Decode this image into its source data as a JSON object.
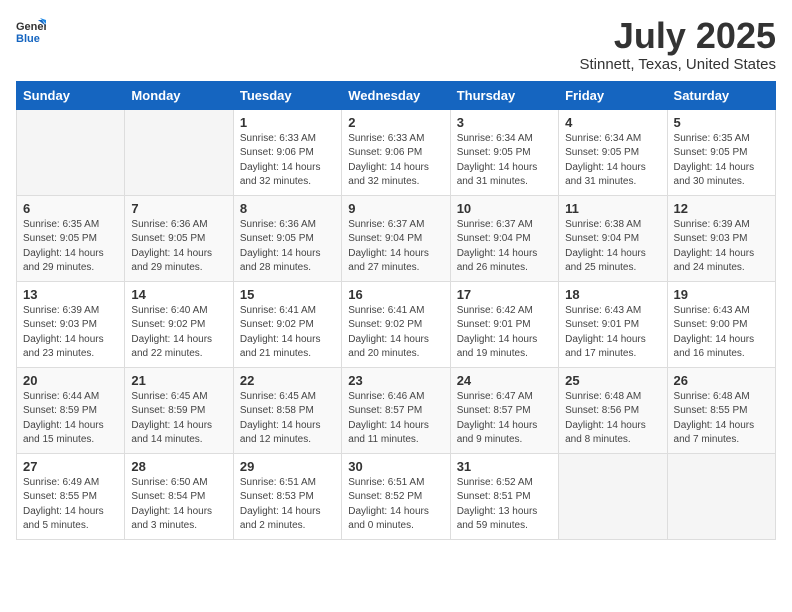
{
  "header": {
    "logo_general": "General",
    "logo_blue": "Blue",
    "month": "July 2025",
    "location": "Stinnett, Texas, United States"
  },
  "weekdays": [
    "Sunday",
    "Monday",
    "Tuesday",
    "Wednesday",
    "Thursday",
    "Friday",
    "Saturday"
  ],
  "weeks": [
    [
      {
        "day": "",
        "sunrise": "",
        "sunset": "",
        "daylight": ""
      },
      {
        "day": "",
        "sunrise": "",
        "sunset": "",
        "daylight": ""
      },
      {
        "day": "1",
        "sunrise": "Sunrise: 6:33 AM",
        "sunset": "Sunset: 9:06 PM",
        "daylight": "Daylight: 14 hours and 32 minutes."
      },
      {
        "day": "2",
        "sunrise": "Sunrise: 6:33 AM",
        "sunset": "Sunset: 9:06 PM",
        "daylight": "Daylight: 14 hours and 32 minutes."
      },
      {
        "day": "3",
        "sunrise": "Sunrise: 6:34 AM",
        "sunset": "Sunset: 9:05 PM",
        "daylight": "Daylight: 14 hours and 31 minutes."
      },
      {
        "day": "4",
        "sunrise": "Sunrise: 6:34 AM",
        "sunset": "Sunset: 9:05 PM",
        "daylight": "Daylight: 14 hours and 31 minutes."
      },
      {
        "day": "5",
        "sunrise": "Sunrise: 6:35 AM",
        "sunset": "Sunset: 9:05 PM",
        "daylight": "Daylight: 14 hours and 30 minutes."
      }
    ],
    [
      {
        "day": "6",
        "sunrise": "Sunrise: 6:35 AM",
        "sunset": "Sunset: 9:05 PM",
        "daylight": "Daylight: 14 hours and 29 minutes."
      },
      {
        "day": "7",
        "sunrise": "Sunrise: 6:36 AM",
        "sunset": "Sunset: 9:05 PM",
        "daylight": "Daylight: 14 hours and 29 minutes."
      },
      {
        "day": "8",
        "sunrise": "Sunrise: 6:36 AM",
        "sunset": "Sunset: 9:05 PM",
        "daylight": "Daylight: 14 hours and 28 minutes."
      },
      {
        "day": "9",
        "sunrise": "Sunrise: 6:37 AM",
        "sunset": "Sunset: 9:04 PM",
        "daylight": "Daylight: 14 hours and 27 minutes."
      },
      {
        "day": "10",
        "sunrise": "Sunrise: 6:37 AM",
        "sunset": "Sunset: 9:04 PM",
        "daylight": "Daylight: 14 hours and 26 minutes."
      },
      {
        "day": "11",
        "sunrise": "Sunrise: 6:38 AM",
        "sunset": "Sunset: 9:04 PM",
        "daylight": "Daylight: 14 hours and 25 minutes."
      },
      {
        "day": "12",
        "sunrise": "Sunrise: 6:39 AM",
        "sunset": "Sunset: 9:03 PM",
        "daylight": "Daylight: 14 hours and 24 minutes."
      }
    ],
    [
      {
        "day": "13",
        "sunrise": "Sunrise: 6:39 AM",
        "sunset": "Sunset: 9:03 PM",
        "daylight": "Daylight: 14 hours and 23 minutes."
      },
      {
        "day": "14",
        "sunrise": "Sunrise: 6:40 AM",
        "sunset": "Sunset: 9:02 PM",
        "daylight": "Daylight: 14 hours and 22 minutes."
      },
      {
        "day": "15",
        "sunrise": "Sunrise: 6:41 AM",
        "sunset": "Sunset: 9:02 PM",
        "daylight": "Daylight: 14 hours and 21 minutes."
      },
      {
        "day": "16",
        "sunrise": "Sunrise: 6:41 AM",
        "sunset": "Sunset: 9:02 PM",
        "daylight": "Daylight: 14 hours and 20 minutes."
      },
      {
        "day": "17",
        "sunrise": "Sunrise: 6:42 AM",
        "sunset": "Sunset: 9:01 PM",
        "daylight": "Daylight: 14 hours and 19 minutes."
      },
      {
        "day": "18",
        "sunrise": "Sunrise: 6:43 AM",
        "sunset": "Sunset: 9:01 PM",
        "daylight": "Daylight: 14 hours and 17 minutes."
      },
      {
        "day": "19",
        "sunrise": "Sunrise: 6:43 AM",
        "sunset": "Sunset: 9:00 PM",
        "daylight": "Daylight: 14 hours and 16 minutes."
      }
    ],
    [
      {
        "day": "20",
        "sunrise": "Sunrise: 6:44 AM",
        "sunset": "Sunset: 8:59 PM",
        "daylight": "Daylight: 14 hours and 15 minutes."
      },
      {
        "day": "21",
        "sunrise": "Sunrise: 6:45 AM",
        "sunset": "Sunset: 8:59 PM",
        "daylight": "Daylight: 14 hours and 14 minutes."
      },
      {
        "day": "22",
        "sunrise": "Sunrise: 6:45 AM",
        "sunset": "Sunset: 8:58 PM",
        "daylight": "Daylight: 14 hours and 12 minutes."
      },
      {
        "day": "23",
        "sunrise": "Sunrise: 6:46 AM",
        "sunset": "Sunset: 8:57 PM",
        "daylight": "Daylight: 14 hours and 11 minutes."
      },
      {
        "day": "24",
        "sunrise": "Sunrise: 6:47 AM",
        "sunset": "Sunset: 8:57 PM",
        "daylight": "Daylight: 14 hours and 9 minutes."
      },
      {
        "day": "25",
        "sunrise": "Sunrise: 6:48 AM",
        "sunset": "Sunset: 8:56 PM",
        "daylight": "Daylight: 14 hours and 8 minutes."
      },
      {
        "day": "26",
        "sunrise": "Sunrise: 6:48 AM",
        "sunset": "Sunset: 8:55 PM",
        "daylight": "Daylight: 14 hours and 7 minutes."
      }
    ],
    [
      {
        "day": "27",
        "sunrise": "Sunrise: 6:49 AM",
        "sunset": "Sunset: 8:55 PM",
        "daylight": "Daylight: 14 hours and 5 minutes."
      },
      {
        "day": "28",
        "sunrise": "Sunrise: 6:50 AM",
        "sunset": "Sunset: 8:54 PM",
        "daylight": "Daylight: 14 hours and 3 minutes."
      },
      {
        "day": "29",
        "sunrise": "Sunrise: 6:51 AM",
        "sunset": "Sunset: 8:53 PM",
        "daylight": "Daylight: 14 hours and 2 minutes."
      },
      {
        "day": "30",
        "sunrise": "Sunrise: 6:51 AM",
        "sunset": "Sunset: 8:52 PM",
        "daylight": "Daylight: 14 hours and 0 minutes."
      },
      {
        "day": "31",
        "sunrise": "Sunrise: 6:52 AM",
        "sunset": "Sunset: 8:51 PM",
        "daylight": "Daylight: 13 hours and 59 minutes."
      },
      {
        "day": "",
        "sunrise": "",
        "sunset": "",
        "daylight": ""
      },
      {
        "day": "",
        "sunrise": "",
        "sunset": "",
        "daylight": ""
      }
    ]
  ]
}
